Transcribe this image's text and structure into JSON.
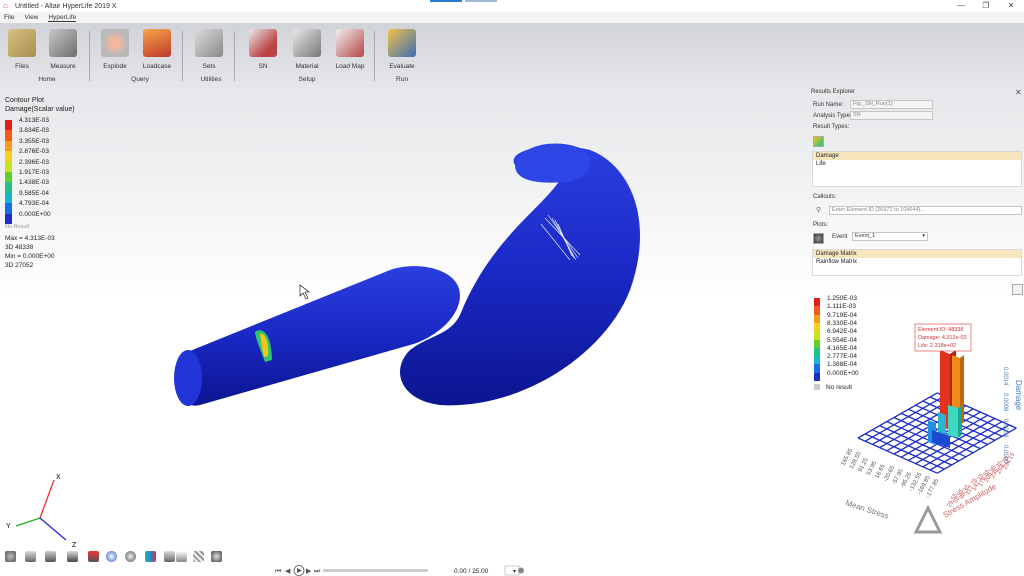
{
  "window": {
    "title": "Untitled - Altair HyperLife 2019 X",
    "minimize": "—",
    "restore": "❐",
    "close": "✕"
  },
  "menu": [
    "File",
    "View",
    "HyperLife"
  ],
  "ribbon": {
    "tools": [
      {
        "id": "files",
        "label": "Files"
      },
      {
        "id": "measure",
        "label": "Measure"
      },
      {
        "id": "explode",
        "label": "Explode"
      },
      {
        "id": "loadcase",
        "label": "Loadcase"
      },
      {
        "id": "sets",
        "label": "Sets"
      },
      {
        "id": "sn",
        "label": "SN"
      },
      {
        "id": "material",
        "label": "Material"
      },
      {
        "id": "loadmap",
        "label": "Load Map"
      },
      {
        "id": "evaluate",
        "label": "Evaluate"
      }
    ],
    "groups": {
      "home": "Home",
      "query": "Query",
      "utilities": "Utilities",
      "setup": "Setup",
      "run": "Run"
    },
    "files_sub": "",
    "material_line2": "Setup",
    "sets_line2": "Utilities",
    "evaluate_line2": "Run"
  },
  "contour": {
    "title": "Contour Plot",
    "subtitle": "Damage(Scalar value)",
    "legend": [
      {
        "label": "4.313E-03",
        "color": "#e21b1b"
      },
      {
        "label": "3.834E-03",
        "color": "#f25a1a"
      },
      {
        "label": "3.355E-03",
        "color": "#f89a1c"
      },
      {
        "label": "2.876E-03",
        "color": "#f6d21c"
      },
      {
        "label": "2.396E-03",
        "color": "#c7e21f"
      },
      {
        "label": "1.917E-03",
        "color": "#5fcf2b"
      },
      {
        "label": "1.438E-03",
        "color": "#22c08a"
      },
      {
        "label": "9.585E-04",
        "color": "#18b5cf"
      },
      {
        "label": "4.793E-04",
        "color": "#1a6fe0"
      },
      {
        "label": "0.000E+00",
        "color": "#1f2dc8"
      }
    ],
    "no_result": "No Result",
    "max": "Max = 4.313E-03",
    "max_id": "3D 48338",
    "min": "Min = 0.000E+00",
    "min_id": "3D 27052"
  },
  "results_explorer": {
    "title": "Results Explorer",
    "run_name_label": "Run Name:",
    "run_name_value": "Fig._SN_Run(1)",
    "analysis_type_label": "Analysis Type:",
    "analysis_type_value": "SN",
    "result_types_label": "Result Types:",
    "result_types": [
      "Damage",
      "Life"
    ],
    "callouts_label": "Callouts:",
    "callouts_placeholder": "Enter Element ID (26972 to 104644)...",
    "plots_label": "Plots:",
    "event_label": "Event",
    "event_value": "Event_1",
    "plots": [
      "Damage Matrix",
      "Rainflow Matrix"
    ]
  },
  "damage_legend": [
    {
      "label": "1.250E-03",
      "color": "#e21b1b"
    },
    {
      "label": "1.111E-03",
      "color": "#f25a1a"
    },
    {
      "label": "9.719E-04",
      "color": "#f89a1c"
    },
    {
      "label": "8.330E-04",
      "color": "#f6d21c"
    },
    {
      "label": "6.942E-04",
      "color": "#c7e21f"
    },
    {
      "label": "5.554E-04",
      "color": "#5fcf2b"
    },
    {
      "label": "4.165E-04",
      "color": "#22c08a"
    },
    {
      "label": "2.777E-04",
      "color": "#18b5cf"
    },
    {
      "label": "1.388E-04",
      "color": "#1a6fe0"
    },
    {
      "label": "0.000E+00",
      "color": "#1f2dc8"
    }
  ],
  "damage_no_result": "No result",
  "callout_box": {
    "line1": "Element ID: 48338",
    "line2": "Damage: 4.313e-03",
    "line3": "Life: 2.318e+02"
  },
  "matrix3d": {
    "z_axis_title": "Damage",
    "z_ticks": [
      "0.0000",
      "0.0004",
      "0.0008",
      "0.0014"
    ],
    "mean_stress_title": "Mean Stress",
    "stress_amp_title": "Stress Amplitude",
    "mean_ticks": [
      "165.85",
      "128.55",
      "91.25",
      "53.95",
      "16.65",
      "-20.65",
      "-57.95",
      "-95.25",
      "-132.55",
      "-169.85",
      "-177.85"
    ],
    "amp_ticks": [
      "294.15",
      "264.75",
      "235.35",
      "205.95",
      "176.55",
      "147.15",
      "117.75",
      "88.35",
      "58.95",
      "29.55"
    ]
  },
  "axes_triad": {
    "x": "X",
    "y": "Y",
    "z": "Z"
  },
  "playback": {
    "time": "0.00 / 25.00"
  }
}
